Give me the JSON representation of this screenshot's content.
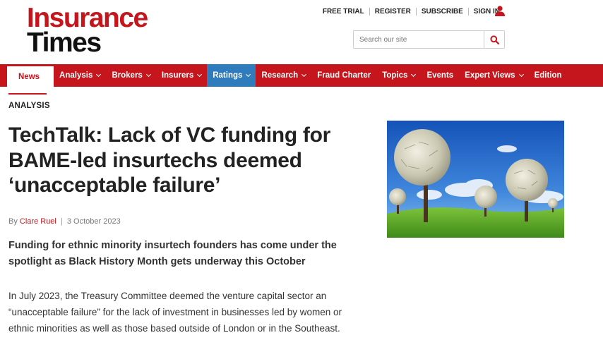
{
  "logo": {
    "line1": "Insurance",
    "line2": "Times"
  },
  "toplinks": [
    "FREE TRIAL",
    "REGISTER",
    "SUBSCRIBE",
    "SIGN IN"
  ],
  "search": {
    "placeholder": "Search our site"
  },
  "nav": [
    {
      "label": "News",
      "dropdown": false
    },
    {
      "label": "Analysis",
      "dropdown": true
    },
    {
      "label": "Brokers",
      "dropdown": true
    },
    {
      "label": "Insurers",
      "dropdown": true
    },
    {
      "label": "Ratings",
      "dropdown": true
    },
    {
      "label": "Research",
      "dropdown": true
    },
    {
      "label": "Fraud Charter",
      "dropdown": false
    },
    {
      "label": "Topics",
      "dropdown": true
    },
    {
      "label": "Events",
      "dropdown": false
    },
    {
      "label": "Expert Views",
      "dropdown": true
    },
    {
      "label": "Edition",
      "dropdown": false
    }
  ],
  "article": {
    "section": "ANALYSIS",
    "headline": "TechTalk: Lack of VC funding for BAME-led insurtechs deemed ‘unacceptable failure’",
    "by": "By",
    "author": "Clare Ruel",
    "date": "3 October 2023",
    "standfirst": "Funding for ethnic minority insurtech founders has come under the spotlight as Black History Month gets underway this October",
    "body": "In July 2023, the Treasury Committee deemed the venture capital sector an “unacceptable failure” for the lack of investment in businesses led by women or ethnic minorities as well as those based outside of London or in the Southeast."
  },
  "colors": {
    "brand": "#c4161c",
    "nav_highlight": "#2e7bbd"
  }
}
